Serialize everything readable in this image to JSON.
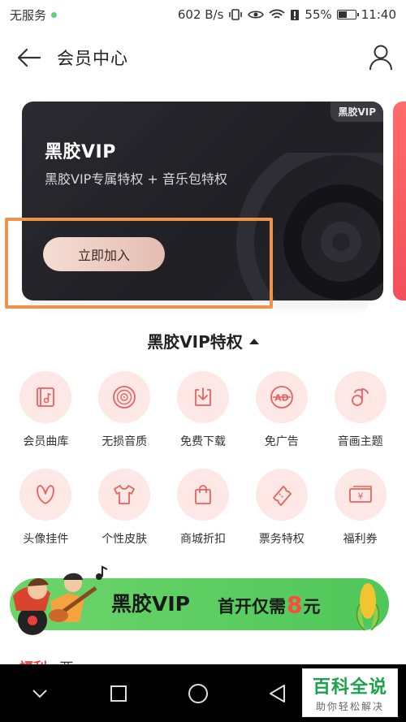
{
  "status_bar": {
    "carrier": "无服务",
    "speed": "602 B/s",
    "battery": "55%",
    "battery_level": 0.55,
    "time": "11:40"
  },
  "header": {
    "title": "会员中心"
  },
  "vip_card": {
    "badge": "黑胶VIP",
    "logo": "黑胶VIP",
    "subtitle": "黑胶VIP专属特权 + 音乐包特权",
    "join_button": "立即加入"
  },
  "privileges": {
    "title": "黑胶VIP特权",
    "items": [
      {
        "label": "会员曲库",
        "icon": "music-library-icon"
      },
      {
        "label": "无损音质",
        "icon": "vinyl-icon"
      },
      {
        "label": "免费下载",
        "icon": "download-icon"
      },
      {
        "label": "免广告",
        "icon": "no-ad-icon"
      },
      {
        "label": "音画主题",
        "icon": "theme-icon"
      },
      {
        "label": "头像挂件",
        "icon": "avatar-pendant-icon"
      },
      {
        "label": "个性皮肤",
        "icon": "tshirt-icon"
      },
      {
        "label": "商城折扣",
        "icon": "shopping-bag-icon"
      },
      {
        "label": "票务特权",
        "icon": "ticket-icon"
      },
      {
        "label": "福利券",
        "icon": "coupon-icon"
      }
    ]
  },
  "banner": {
    "logo": "黑胶VIP",
    "text_prefix": "首开仅需",
    "number": "8",
    "text_suffix": "元"
  },
  "peek": {
    "tag": "福利",
    "text": "两"
  },
  "watermark": {
    "title": "百科全说",
    "subtitle": "助你轻松解决"
  },
  "colors": {
    "card_bg": "#1f1f24",
    "accent_red": "#ff4a3a",
    "banner_green": "#5ccf63",
    "highlight_orange": "#f0924a",
    "icon_pink": "#fde8e6"
  }
}
